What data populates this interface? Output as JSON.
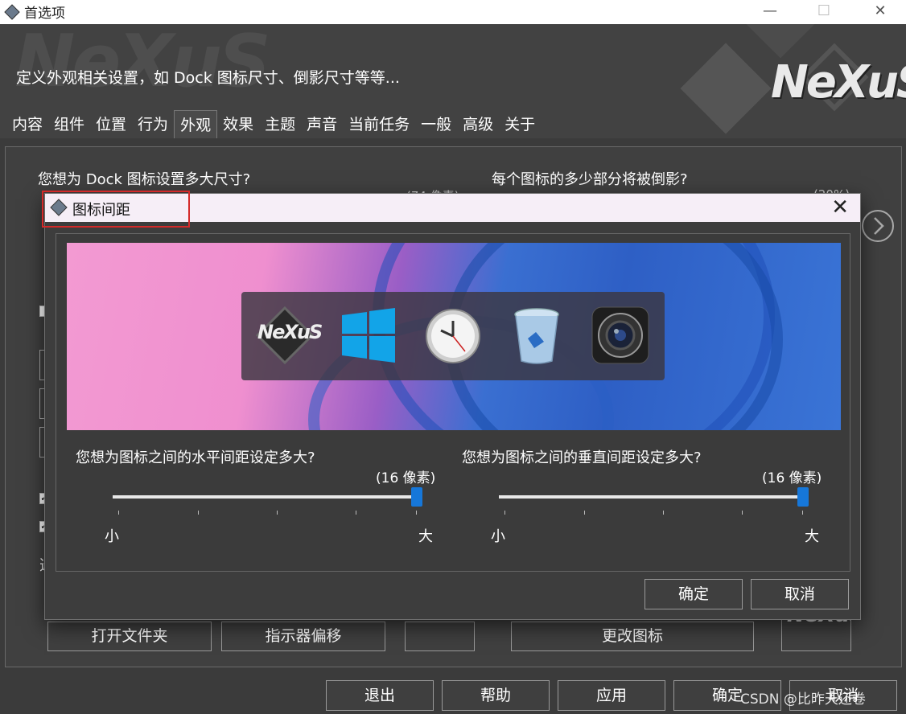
{
  "window": {
    "title": "首选项",
    "minimize": "—",
    "maximize": "☐",
    "close": "✕"
  },
  "header": {
    "description": "定义外观相关设置，如 Dock 图标尺寸、倒影尺寸等等...",
    "logo": "NeXuS",
    "watermark": "NeXuS"
  },
  "tabs": [
    {
      "label": "内容",
      "active": false
    },
    {
      "label": "组件",
      "active": false
    },
    {
      "label": "位置",
      "active": false
    },
    {
      "label": "行为",
      "active": false
    },
    {
      "label": "外观",
      "active": true
    },
    {
      "label": "效果",
      "active": false
    },
    {
      "label": "主题",
      "active": false
    },
    {
      "label": "声音",
      "active": false
    },
    {
      "label": "当前任务",
      "active": false
    },
    {
      "label": "一般",
      "active": false
    },
    {
      "label": "高级",
      "active": false
    },
    {
      "label": "关于",
      "active": false
    }
  ],
  "content": {
    "question_icon_size": "您想为 Dock 图标设置多大尺寸?",
    "question_reflection": "每个图标的多少部分将被倒影?",
    "hidden_label_1": "(74 像素)",
    "hidden_label_2": "(20%)",
    "partial_text": "选",
    "buttons": {
      "open_folder": "打开文件夹",
      "indicator_offset": "指示器偏移",
      "change_icon": "更改图标"
    },
    "mini_logo": "NeXuS"
  },
  "footer": {
    "exit": "退出",
    "help": "帮助",
    "apply": "应用",
    "ok": "确定",
    "cancel": "取消"
  },
  "dialog": {
    "title": "图标间距",
    "close": "✕",
    "dock_logo": "NeXuS",
    "horizontal": {
      "question": "您想为图标之间的水平间距设定多大?",
      "value_label": "(16 像素)",
      "min": "小",
      "max": "大",
      "value_fraction": 1.0
    },
    "vertical": {
      "question": "您想为图标之间的垂直间距设定多大?",
      "value_label": "(16 像素)",
      "min": "小",
      "max": "大",
      "value_fraction": 1.0
    },
    "ok": "确定",
    "cancel": "取消"
  },
  "watermark_text": "CSDN @比昨天还卷",
  "colors": {
    "accent": "#1677d9",
    "highlight": "#d42a2a",
    "background": "#3b3b3b"
  }
}
